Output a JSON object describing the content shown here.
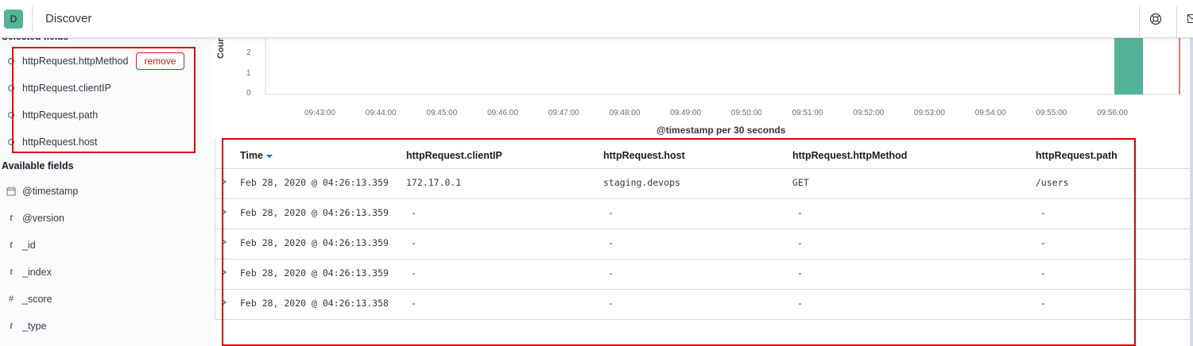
{
  "header": {
    "avatar_letter": "D",
    "title": "Discover",
    "help_icon": "help-lifebuoy-icon",
    "mail_icon": "mail-icon"
  },
  "sidebar": {
    "selected_title": "Selected fields",
    "selected_fields": [
      {
        "name": "httpRequest.httpMethod",
        "icon": "string-type-icon"
      },
      {
        "name": "httpRequest.clientIP",
        "icon": "string-type-icon"
      },
      {
        "name": "httpRequest.path",
        "icon": "string-type-icon"
      },
      {
        "name": "httpRequest.host",
        "icon": "string-type-icon"
      }
    ],
    "remove_label": "remove",
    "available_title": "Available fields",
    "available_fields": [
      {
        "name": "@timestamp",
        "icon": "calendar-icon",
        "glyph": ""
      },
      {
        "name": "@version",
        "icon": "text-type-icon",
        "glyph": "t"
      },
      {
        "name": "_id",
        "icon": "text-type-icon",
        "glyph": "t"
      },
      {
        "name": "_index",
        "icon": "text-type-icon",
        "glyph": "t"
      },
      {
        "name": "_score",
        "icon": "number-type-icon",
        "glyph": "#"
      },
      {
        "name": "_type",
        "icon": "text-type-icon",
        "glyph": "t"
      }
    ]
  },
  "chart": {
    "y_label": "Count",
    "y_ticks": [
      "2",
      "1",
      "0"
    ],
    "x_ticks": [
      "09:43:00",
      "09:44:00",
      "09:45:00",
      "09:46:00",
      "09:47:00",
      "09:48:00",
      "09:49:00",
      "09:50:00",
      "09:51:00",
      "09:52:00",
      "09:53:00",
      "09:54:00",
      "09:55:00",
      "09:56:00"
    ],
    "x_label": "@timestamp per 30 seconds",
    "bar_color": "#54b399",
    "now_line_color": "#bd271e"
  },
  "chart_data": {
    "type": "bar",
    "title": "",
    "xlabel": "@timestamp per 30 seconds",
    "ylabel": "Count",
    "categories": [
      "09:56:00"
    ],
    "values": [
      5
    ],
    "ylim": [
      0,
      5
    ]
  },
  "table": {
    "columns": [
      "Time",
      "httpRequest.clientIP",
      "httpRequest.host",
      "httpRequest.httpMethod",
      "httpRequest.path"
    ],
    "rows": [
      [
        "Feb 28, 2020 @ 04:26:13.359",
        "172.17.0.1",
        "staging.devops",
        "GET",
        "/users"
      ],
      [
        "Feb 28, 2020 @ 04:26:13.359",
        "-",
        "-",
        "-",
        "-"
      ],
      [
        "Feb 28, 2020 @ 04:26:13.359",
        "-",
        "-",
        "-",
        "-"
      ],
      [
        "Feb 28, 2020 @ 04:26:13.359",
        "-",
        "-",
        "-",
        "-"
      ],
      [
        "Feb 28, 2020 @ 04:26:13.358",
        "-",
        "-",
        "-",
        "-"
      ]
    ]
  }
}
